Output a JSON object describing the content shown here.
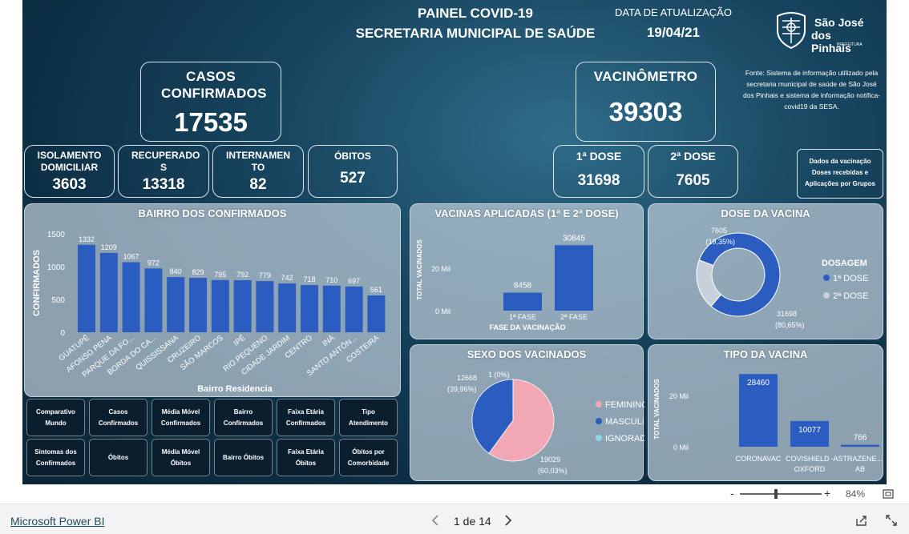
{
  "header": {
    "title_line1": "PAINEL COVID-19",
    "title_line2": "SECRETARIA MUNICIPAL DE SAÚDE",
    "update_label": "DATA DE ATUALIZAÇÃO",
    "update_date": "19/04/21",
    "logo_line1": "São José",
    "logo_line2": "dos Pinhais",
    "logo_sub": "PREFEITURA",
    "source_note": "Fonte: Sistema de informação utilizado pela secretaria municipal de saúde de São José dos Pinhais e sistema de informação notifica-covid19 da SESA."
  },
  "kpis": {
    "casos_title": "CASOS CONFIRMADOS",
    "casos_value": "17535",
    "vacinometro_title": "VACINÔMETRO",
    "vacinometro_value": "39303",
    "isolamento_title": "ISOLAMENTO DOMICILIAR",
    "isolamento_value": "3603",
    "recuperados_title": "RECUPERADO S",
    "recuperados_value": "13318",
    "internamento_title": "INTERNAMEN TO",
    "internamento_value": "82",
    "obitos_title": "ÓBITOS",
    "obitos_value": "527",
    "dose1_title": "1ª DOSE",
    "dose1_value": "31698",
    "dose2_title": "2ª DOSE",
    "dose2_value": "7605",
    "vac_info_line1": "Dados da vacinação",
    "vac_info_line2": "Doses recebidas e",
    "vac_info_line3": "Aplicações por Grupos"
  },
  "nav_buttons": [
    {
      "line1": "Comparativo",
      "line2": "Mundo"
    },
    {
      "line1": "Casos",
      "line2": "Confirmados"
    },
    {
      "line1": "Média Móvel",
      "line2": "Confirmados"
    },
    {
      "line1": "Bairro",
      "line2": "Confirmados"
    },
    {
      "line1": "Faixa Etária",
      "line2": "Confirmados"
    },
    {
      "line1": "Tipo",
      "line2": "Atendimento"
    },
    {
      "line1": "Sintomas dos",
      "line2": "Confirmados"
    },
    {
      "line1": "Óbitos",
      "line2": ""
    },
    {
      "line1": "Média Móvel",
      "line2": "Óbitos"
    },
    {
      "line1": "Bairro Óbitos",
      "line2": ""
    },
    {
      "line1": "Faixa Etária",
      "line2": "Óbitos"
    },
    {
      "line1": "Óbitos por",
      "line2": "Comorbidade"
    }
  ],
  "chart_data": [
    {
      "id": "bairro",
      "type": "bar",
      "title": "BAIRRO DOS CONFIRMADOS",
      "xlabel": "Bairro Residencia",
      "ylabel": "CONFIRMADOS",
      "ylim": [
        0,
        1500
      ],
      "yticks": [
        "0",
        "500",
        "1000",
        "1500"
      ],
      "categories": [
        "GUATUPÊ",
        "AFONSO PENA",
        "PARQUE DA FO...",
        "BORDA DO CA...",
        "QUISSISSANA",
        "CRUZEIRO",
        "SÃO MARCOS",
        "IPÊ",
        "RIO PEQUENO",
        "CIDADE JARDIM",
        "CENTRO",
        "INÁ",
        "SANTO ANTÔN...",
        "COSTEIRA"
      ],
      "values": [
        1332,
        1209,
        1067,
        972,
        840,
        829,
        795,
        792,
        779,
        742,
        718,
        710,
        697,
        561
      ],
      "color": "#2b5cbf"
    },
    {
      "id": "vacinas",
      "type": "bar",
      "title": "VACINAS APLICADAS (1ª E 2ª DOSE)",
      "xlabel": "FASE DA VACINAÇÃO",
      "ylabel": "TOTAL VACINADOS",
      "yticks": [
        "0 Mil",
        "20 Mil"
      ],
      "categories": [
        "1ª FASE",
        "2ª FASE"
      ],
      "values": [
        8458,
        30845
      ],
      "color": "#2b5cbf"
    },
    {
      "id": "dose",
      "type": "pie",
      "title": "DOSE DA VACINA",
      "legend_title": "DOSAGEM",
      "slices": [
        {
          "name": "1ª DOSE",
          "value": 31698,
          "pct": "(80,65%)",
          "color": "#2b5cbf"
        },
        {
          "name": "2ª DOSE",
          "value": 7605,
          "pct": "(19,35%)",
          "color": "#c8d0dc"
        }
      ]
    },
    {
      "id": "sexo",
      "type": "pie",
      "title": "SEXO DOS VACINADOS",
      "slices": [
        {
          "name": "FEMININO",
          "value": 19029,
          "pct": "(60,03%)",
          "color": "#f2a7b5"
        },
        {
          "name": "MASCULINO",
          "value": 12668,
          "pct": "(39,96%)",
          "color": "#2b5cbf"
        },
        {
          "name": "IGNORAD...",
          "value": 1,
          "pct": "(0%)",
          "color": "#8fd6e6"
        }
      ]
    },
    {
      "id": "tipo",
      "type": "bar",
      "title": "TIPO DA VACINA",
      "ylabel": "TOTAL VACINADOS",
      "yticks": [
        "0 Mil",
        "20 Mil"
      ],
      "categories": [
        "CORONAVAC",
        "COVISHIELD - OXFORD",
        "ASTRAZENE... - AB"
      ],
      "values": [
        28460,
        10077,
        766
      ],
      "color": "#2b5cbf"
    }
  ],
  "footer": {
    "brand": "Microsoft Power BI",
    "page_indicator": "1 de 14",
    "zoom": "84%",
    "zoom_level_pct": 84,
    "zoom_minus": "-",
    "zoom_plus": "+"
  }
}
